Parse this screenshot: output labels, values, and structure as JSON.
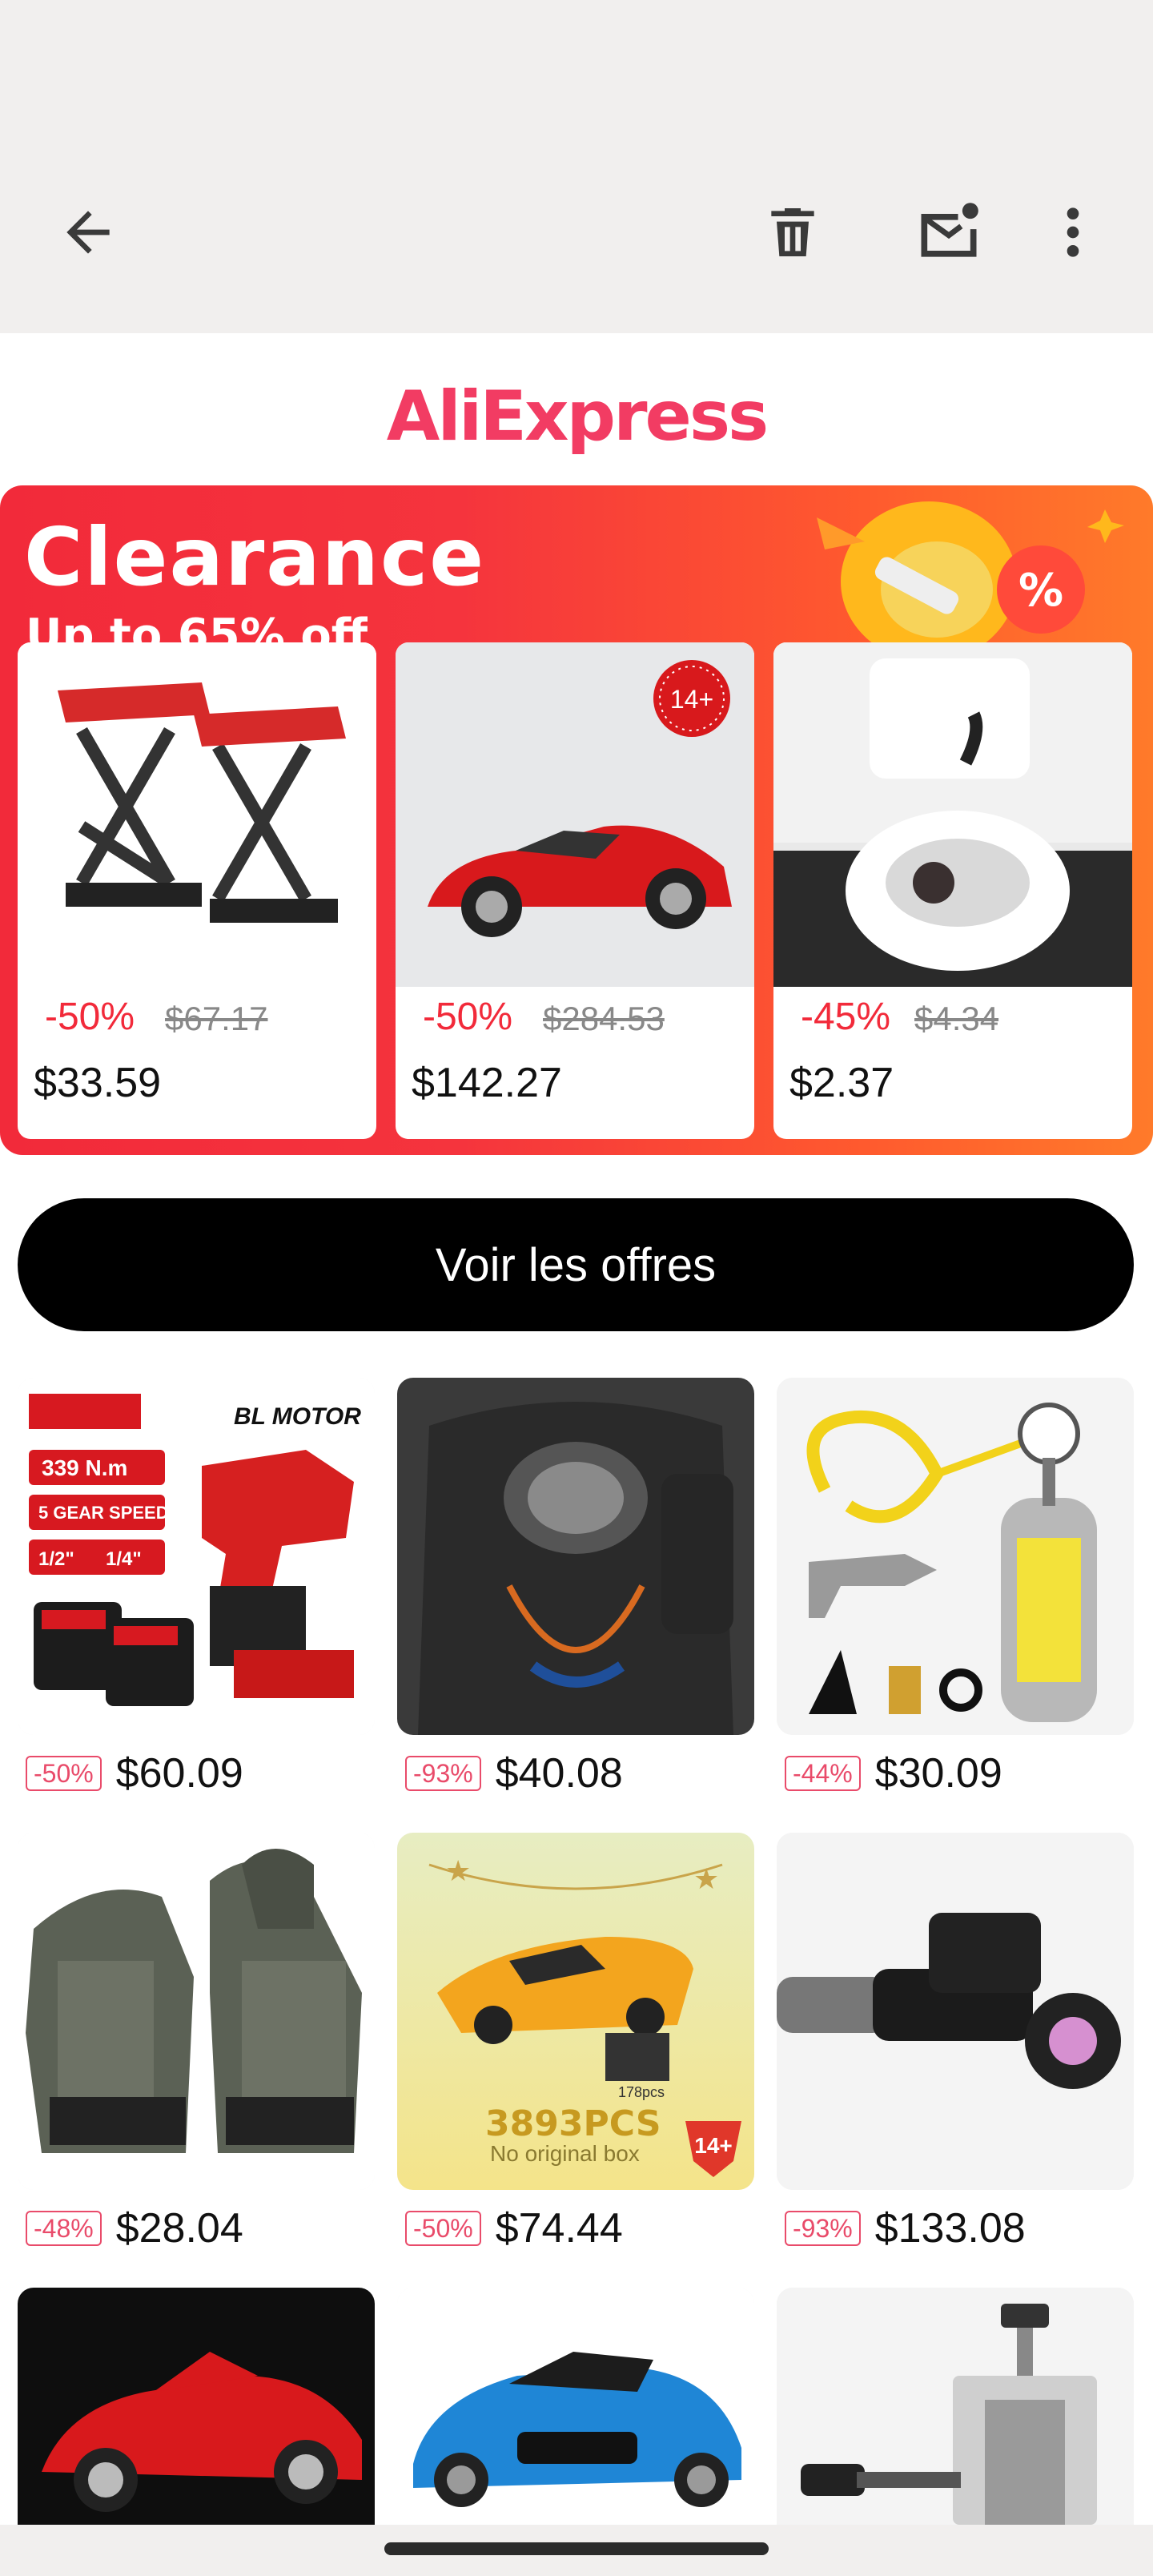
{
  "app_bar": {
    "back_icon": "arrow-left-icon",
    "delete_icon": "trash-icon",
    "unread_icon": "mail-unread-icon",
    "more_icon": "more-vertical-icon"
  },
  "logo": {
    "text": "AliExpress",
    "color": "#f23c63"
  },
  "banner": {
    "title": "Clearance",
    "subtitle": "Up to 65% off",
    "deals": [
      {
        "discount": "-50%",
        "original": "$67.17",
        "price": "$33.59",
        "image": "scissor-lift"
      },
      {
        "discount": "-50%",
        "original": "$284.53",
        "price": "$142.27",
        "image": "red-sports-car-model",
        "age_badge": "14+"
      },
      {
        "discount": "-45%",
        "original": "$4.34",
        "price": "$2.37",
        "image": "cat-toilet-training"
      }
    ]
  },
  "cta": {
    "label": "Voir les offres"
  },
  "products": [
    {
      "discount": "-50%",
      "price": "$60.09",
      "image": "impact-wrench",
      "label1": "339 N.m",
      "label2": "5 GEAR SPEED",
      "label3": "1/2\"",
      "label4": "1/4\"",
      "brand": "BL MOTOR"
    },
    {
      "discount": "-93%",
      "price": "$40.08",
      "image": "tactical-vest"
    },
    {
      "discount": "-44%",
      "price": "$30.09",
      "image": "air-tank-kit"
    },
    {
      "discount": "-48%",
      "price": "$28.04",
      "image": "tactical-jacket"
    },
    {
      "discount": "-50%",
      "price": "$74.44",
      "image": "lego-sports-car",
      "pcs_small": "178pcs",
      "pcs": "3893PCS",
      "note": "No original box",
      "age": "14+"
    },
    {
      "discount": "-93%",
      "price": "$133.08",
      "image": "night-vision-scope"
    },
    {
      "image": "red-supercar-model"
    },
    {
      "image": "blue-hypercar-model"
    },
    {
      "image": "cable-stripper-tool"
    }
  ]
}
